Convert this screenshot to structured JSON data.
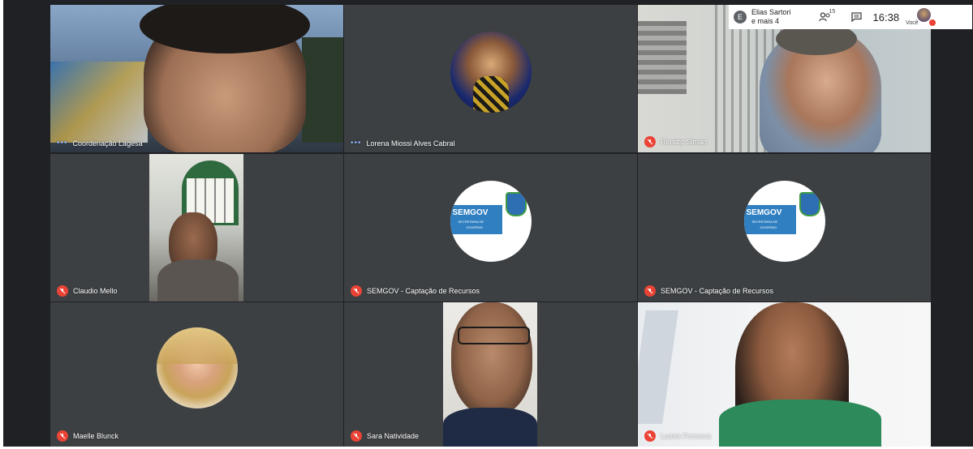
{
  "participants": [
    {
      "name": "Coordenação Lagesa",
      "status": "speaking"
    },
    {
      "name": "Lorena Miossi Alves Cabral",
      "status": "speaking"
    },
    {
      "name": "Renato Siman",
      "status": "muted"
    },
    {
      "name": "Claudio Mello",
      "status": "muted"
    },
    {
      "name": "SEMGOV - Captação de Recursos",
      "status": "muted"
    },
    {
      "name": "SEMGOV - Captação de Recursos",
      "status": "muted"
    },
    {
      "name": "Maelle Blunck",
      "status": "muted"
    },
    {
      "name": "Sara Natividade",
      "status": "muted"
    },
    {
      "name": "Luana Fonseca",
      "status": "muted"
    }
  ],
  "semgov_logo": {
    "title": "SEMGOV",
    "line1": "SECRETARIA DE",
    "line2": "GOVERNO"
  },
  "topbar": {
    "presenter_initial": "E",
    "presenter_name": "Elias Sartori",
    "presenter_more": "e mais 4",
    "people_count": "15",
    "clock": "16:38",
    "self_label": "Você"
  },
  "colors": {
    "accent_mute": "#ea4335",
    "tile_bg": "#3c4043",
    "speaking": "#8ab4f8"
  }
}
